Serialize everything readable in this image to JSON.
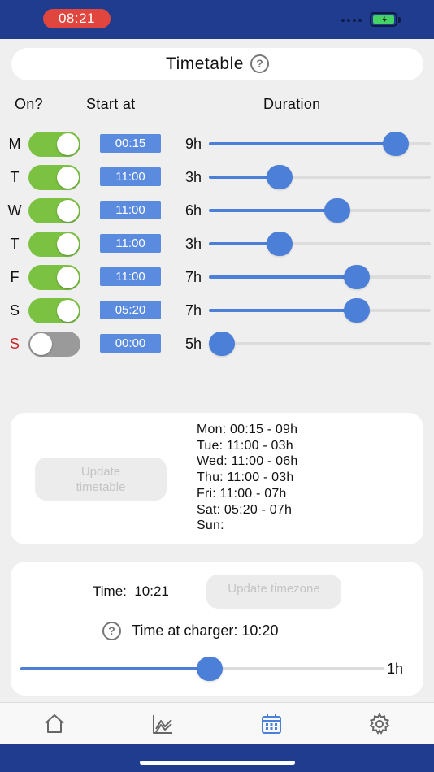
{
  "status_bar": {
    "time": "08:21"
  },
  "title": {
    "text": "Timetable",
    "help_glyph": "?"
  },
  "headers": {
    "on": "On?",
    "start": "Start at",
    "duration": "Duration"
  },
  "max_duration_hours": 12,
  "schedule": [
    {
      "day": "M",
      "on": true,
      "start": "00:15",
      "duration_label": "9h",
      "duration_hours": 9,
      "day_color": "#111111"
    },
    {
      "day": "T",
      "on": true,
      "start": "11:00",
      "duration_label": "3h",
      "duration_hours": 3,
      "day_color": "#111111"
    },
    {
      "day": "W",
      "on": true,
      "start": "11:00",
      "duration_label": "6h",
      "duration_hours": 6,
      "day_color": "#111111"
    },
    {
      "day": "T",
      "on": true,
      "start": "11:00",
      "duration_label": "3h",
      "duration_hours": 3,
      "day_color": "#111111"
    },
    {
      "day": "F",
      "on": true,
      "start": "11:00",
      "duration_label": "7h",
      "duration_hours": 7,
      "day_color": "#111111"
    },
    {
      "day": "S",
      "on": true,
      "start": "05:20",
      "duration_label": "7h",
      "duration_hours": 7,
      "day_color": "#111111"
    },
    {
      "day": "S",
      "on": false,
      "start": "00:00",
      "duration_label": "5h",
      "duration_hours": 0,
      "day_color": "#c8252b"
    }
  ],
  "update_timetable": {
    "line1": "Update",
    "line2": "timetable"
  },
  "summary": [
    "Mon: 00:15 - 09h",
    "Tue: 11:00 - 03h",
    "Wed: 11:00 - 06h",
    "Thu: 11:00 - 03h",
    "Fri: 11:00 - 07h",
    "Sat: 05:20 - 07h",
    "Sun:"
  ],
  "timezone": {
    "time_label": "Time:",
    "time_value": "10:21",
    "update_label": "Update timezone",
    "help_glyph": "?",
    "charger_label": "Time at charger:",
    "charger_value": "10:20",
    "offset_label": "1h",
    "offset_fraction": 0.52
  },
  "tabs": [
    {
      "name": "home",
      "active": false
    },
    {
      "name": "chart",
      "active": false
    },
    {
      "name": "calendar",
      "active": true
    },
    {
      "name": "settings",
      "active": false
    }
  ],
  "colors": {
    "accent": "#4b7fd8",
    "toggle_on": "#7cc242",
    "toggle_off": "#9a9a9a",
    "bar": "#1f3c8f",
    "sunday": "#c8252b",
    "clock_pill": "#e0453e"
  }
}
